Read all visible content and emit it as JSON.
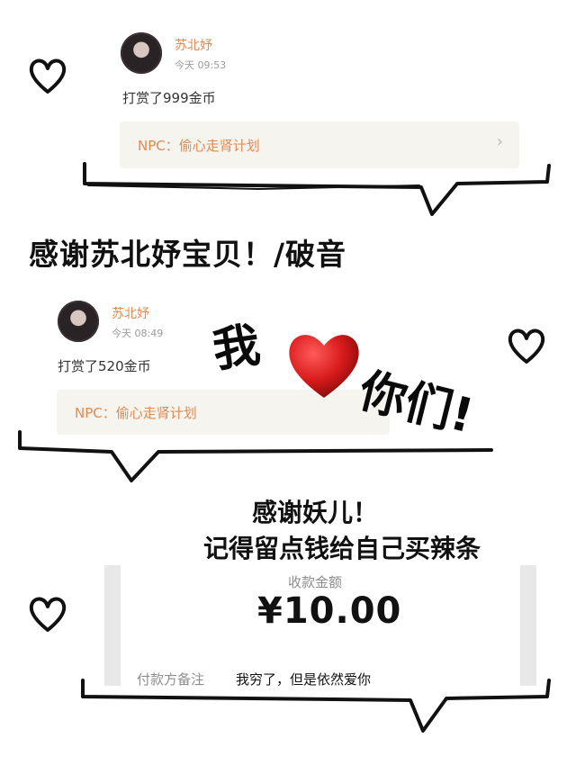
{
  "post1": {
    "name": "苏北妤",
    "time": "今天 09:53",
    "reward": "打赏了999金币",
    "npc": "NPC：偷心走肾计划"
  },
  "caption1": "感谢苏北妤宝贝！/破音",
  "post2": {
    "name": "苏北妤",
    "time": "今天 08:49",
    "reward": "打赏了520金币",
    "npc": "NPC：偷心走肾计划"
  },
  "love": {
    "wo": "我",
    "nimen": "你们!",
    "heart_color": "#d81b1b"
  },
  "thanks": {
    "line1": "感谢妖儿！",
    "line2": "记得留点钱给自己买辣条"
  },
  "payment": {
    "label": "收款金额",
    "amount": "¥10.00",
    "remark_label": "付款方备注",
    "remark_value": "我穷了，但是依然爱你"
  },
  "icons": {
    "chevron": "chevron-right-icon",
    "heart": "heart-icon"
  }
}
